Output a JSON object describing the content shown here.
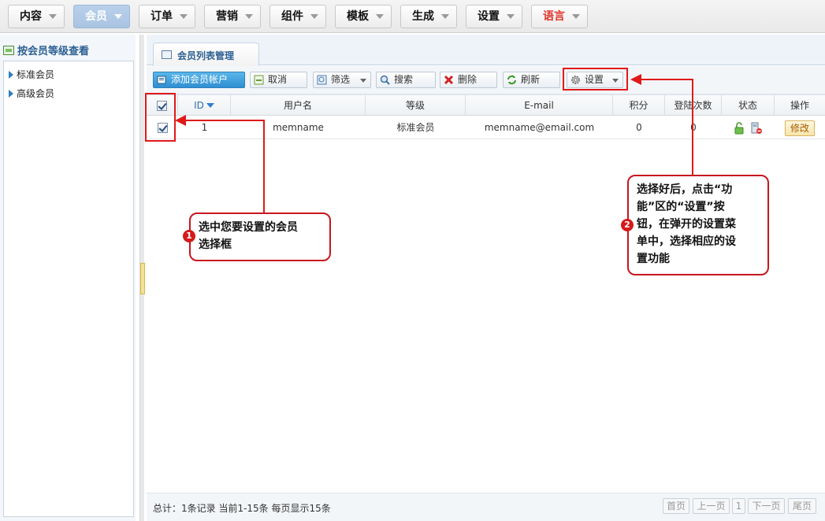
{
  "nav": {
    "tabs": [
      {
        "label": "内容"
      },
      {
        "label": "会员"
      },
      {
        "label": "订单"
      },
      {
        "label": "营销"
      },
      {
        "label": "组件"
      },
      {
        "label": "模板"
      },
      {
        "label": "生成"
      },
      {
        "label": "设置"
      },
      {
        "label": "语言"
      }
    ],
    "active": "会员",
    "colors": {
      "active_bg": "#a9c4e3",
      "language_text": "#e0362b"
    }
  },
  "sidebar": {
    "title": "按会员等级查看",
    "items": [
      {
        "label": "标准会员"
      },
      {
        "label": "高级会员"
      }
    ]
  },
  "main": {
    "tab_label": "会员列表管理",
    "toolbar": {
      "add": "添加会员帐户",
      "cancel": "取消",
      "filter": "筛选",
      "search": "搜索",
      "delete": "删除",
      "refresh": "刷新",
      "settings": "设置"
    },
    "table": {
      "headers": [
        "ID",
        "用户名",
        "等级",
        "E-mail",
        "积分",
        "登陆次数",
        "状态",
        "操作"
      ],
      "rows": [
        {
          "id": "1",
          "username": "memname",
          "level": "标准会员",
          "email": "memname@email.com",
          "points": "0",
          "logins": "0",
          "action": "修改"
        }
      ]
    },
    "footer": {
      "info": "总计：1条记录 当前1-15条 每页显示15条",
      "first": "首页",
      "prev": "上一页",
      "page": "1",
      "next": "下一页",
      "last": "尾页"
    }
  },
  "annotations": {
    "step1": {
      "num": "1",
      "text1": "选中您要设置的会员",
      "text2": "选择框"
    },
    "step2": {
      "num": "2",
      "line1": "选择好后，点击“功",
      "line2": "能”区的“设置”按",
      "line3": "钮，在弹开的设置菜",
      "line4": "单中，选择相应的设",
      "line5": "置功能"
    },
    "color": "#e01919"
  }
}
